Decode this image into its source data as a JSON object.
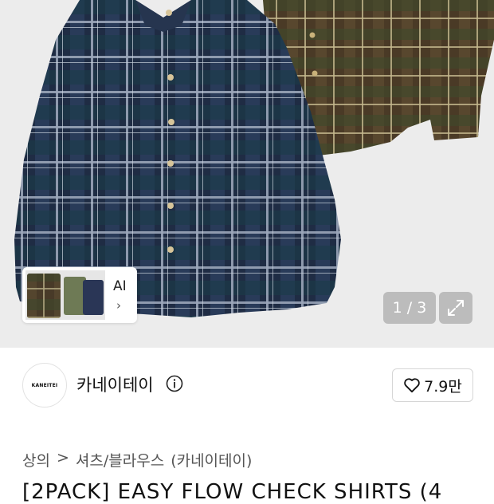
{
  "gallery": {
    "pager_text": "1 / 3",
    "ai_label": "AI",
    "ai_chevron": "›",
    "expand_icon": "expand-icon"
  },
  "brand": {
    "logo_text": "KANEITEI",
    "name": "카네이테이",
    "info_icon": "info-icon",
    "likes": "7.9만",
    "heart_icon": "heart-icon"
  },
  "breadcrumb": {
    "items": [
      "상의",
      "셔츠/블라우스",
      "(카네이테이)"
    ],
    "separator": ">"
  },
  "product": {
    "title": "[2PACK] EASY FLOW CHECK SHIRTS (4"
  }
}
